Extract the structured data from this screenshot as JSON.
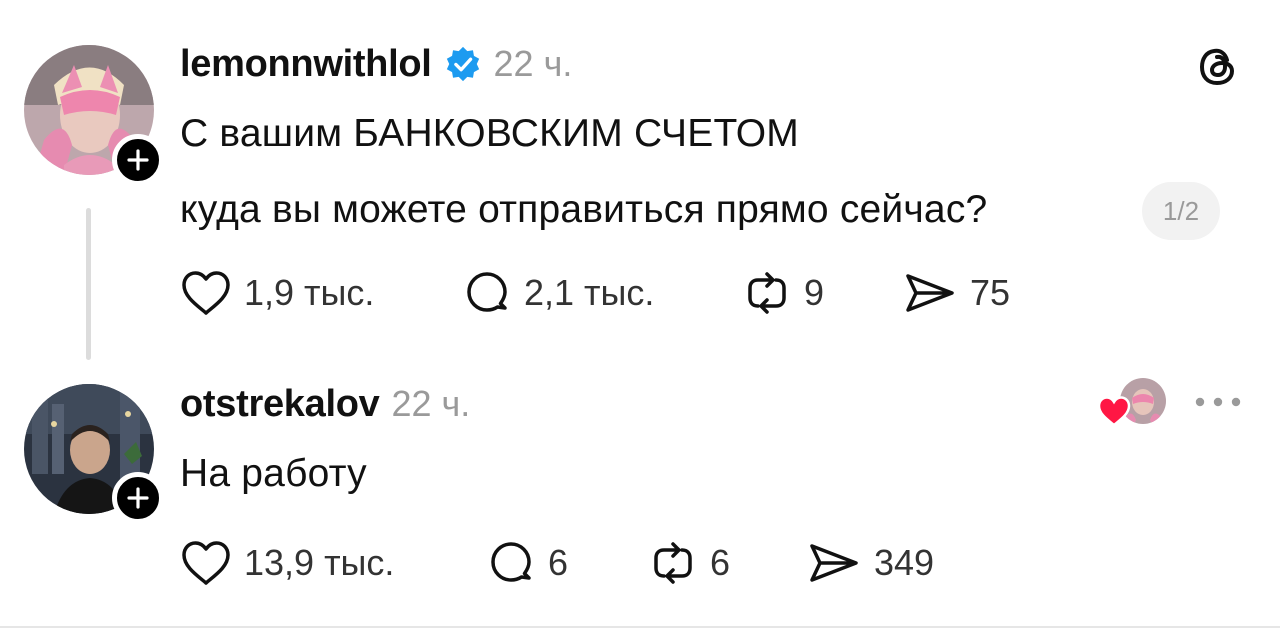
{
  "posts": [
    {
      "username": "lemonnwithlol",
      "verified": true,
      "time": "22 ч.",
      "text_lines": [
        "С вашим БАНКОВСКИМ СЧЕТОМ",
        "куда вы можете отправиться прямо сейчас?"
      ],
      "page_indicator": "1/2",
      "stats": {
        "likes": "1,9 тыс.",
        "replies": "2,1 тыс.",
        "reposts": "9",
        "shares": "75"
      }
    },
    {
      "username": "otstrekalov",
      "verified": false,
      "time": "22 ч.",
      "text_lines": [
        "На работу"
      ],
      "stats": {
        "likes": "13,9 тыс.",
        "replies": "6",
        "reposts": "6",
        "shares": "349"
      }
    }
  ],
  "icons": {
    "app_logo": "threads-logo-icon",
    "verified": "verified-badge-icon",
    "like": "heart-icon",
    "reply": "comment-bubble-icon",
    "repost": "repost-icon",
    "share": "send-icon",
    "more": "more-options-icon",
    "follow": "plus-icon"
  },
  "colors": {
    "verified_blue": "#1d9bf0",
    "liked_red": "#ff1744",
    "muted_text": "#9a9a9a",
    "primary_text": "#111111"
  }
}
